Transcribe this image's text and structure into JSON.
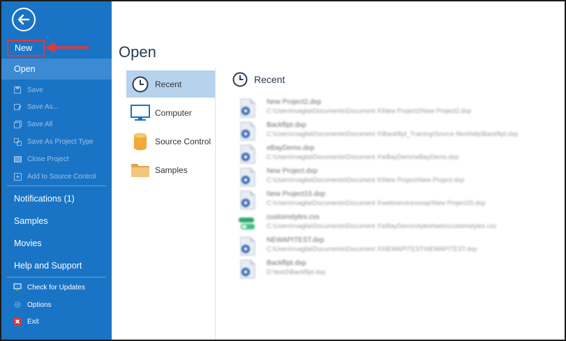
{
  "sidebar": {
    "back_icon": "arrow-left-icon",
    "new_label": "New",
    "open_label": "Open",
    "file_items": [
      {
        "label": "Save",
        "icon": "save-icon",
        "enabled": false
      },
      {
        "label": "Save As...",
        "icon": "save-as-icon",
        "enabled": false
      },
      {
        "label": "Save All",
        "icon": "save-all-icon",
        "enabled": false
      },
      {
        "label": "Save As Project Type",
        "icon": "save-project-type-icon",
        "enabled": false
      },
      {
        "label": "Close Project",
        "icon": "close-project-icon",
        "enabled": false
      },
      {
        "label": "Add to Source Control",
        "icon": "source-control-icon",
        "enabled": false
      }
    ],
    "sections": [
      {
        "label": "Notifications (1)"
      },
      {
        "label": "Samples"
      },
      {
        "label": "Movies"
      },
      {
        "label": "Help and Support"
      }
    ],
    "bottom_items": [
      {
        "label": "Check for Updates",
        "icon": "check-updates-icon"
      },
      {
        "label": "Options",
        "icon": "gear-icon"
      },
      {
        "label": "Exit",
        "icon": "exit-icon"
      }
    ],
    "colors": {
      "background": "#1a74c5",
      "selected": "#3c8ad3",
      "highlight_border": "#e0393b"
    }
  },
  "main": {
    "title": "Open",
    "nav": [
      {
        "label": "Recent",
        "icon": "clock-icon",
        "selected": true
      },
      {
        "label": "Computer",
        "icon": "monitor-icon",
        "selected": false
      },
      {
        "label": "Source Control",
        "icon": "database-icon",
        "selected": false
      },
      {
        "label": "Samples",
        "icon": "folder-icon",
        "selected": false
      }
    ],
    "recent_heading": "Recent",
    "recent_files": [
      {
        "name": "New Project2.dxp",
        "path": "C:\\Users\\rvaglia\\Documents\\Document X\\New Project2\\New Project2.dxp",
        "icon": "project-file-icon"
      },
      {
        "name": "Backflipt.dxp",
        "path": "C:\\Users\\rvaglia\\Documents\\Document X\\Backflipt_Training\\Source files\\help\\Backflipt.dxp",
        "icon": "project-file-icon"
      },
      {
        "name": "eBayDemo.dxp",
        "path": "C:\\Users\\rvaglia\\Documents\\Document X\\eBayDemo\\eBayDemo.dxp",
        "icon": "project-file-icon"
      },
      {
        "name": "New Project.dxp",
        "path": "C:\\Users\\rvaglia\\Documents\\Document X\\New Project\\New Project.dxp",
        "icon": "project-file-icon"
      },
      {
        "name": "New Project15.dxp",
        "path": "C:\\Users\\rvaglia\\Documents\\Document X\\webservicessoap\\New Project15.dxp",
        "icon": "project-file-icon"
      },
      {
        "name": "customstyles.css",
        "path": "C:\\Users\\rvaglia\\Documents\\Document X\\eBayDemo\\stylesheets\\customstyles.css",
        "icon": "css-file-icon"
      },
      {
        "name": "NEWAPITEST.dxp",
        "path": "C:\\Users\\rvaglia\\Documents\\Document X\\NEWAPITEST\\NEWAPITEST.dxp",
        "icon": "project-file-icon"
      },
      {
        "name": "Backflipt.dxp",
        "path": "D:\\test2\\Backflipt.dxp",
        "icon": "project-file-icon"
      }
    ]
  }
}
